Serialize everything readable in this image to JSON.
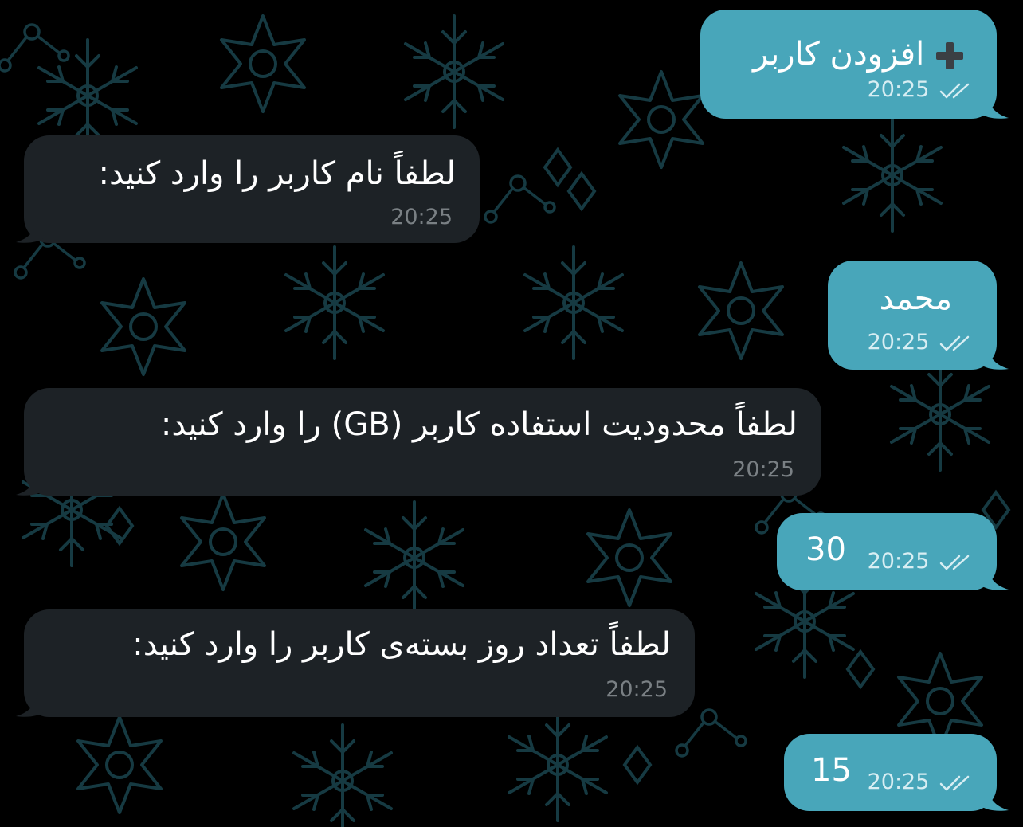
{
  "colors": {
    "background": "#000000",
    "pattern": "#16333a",
    "incoming_bubble": "#1d2226",
    "outgoing_bubble": "#48a6ba",
    "incoming_time": "#7a8084",
    "outgoing_time": "#d8eef3"
  },
  "messages": [
    {
      "direction": "outgoing",
      "text": "افزودن کاربر",
      "icon": "plus-icon",
      "time": "20:25",
      "status": "read-double-check"
    },
    {
      "direction": "incoming",
      "text": "لطفاً نام کاربر را وارد کنید:",
      "time": "20:25"
    },
    {
      "direction": "outgoing",
      "text": "محمد",
      "time": "20:25",
      "status": "read-double-check"
    },
    {
      "direction": "incoming",
      "text": "لطفاً محدودیت استفاده کاربر (GB) را وارد کنید:",
      "time": "20:25"
    },
    {
      "direction": "outgoing",
      "text": "30",
      "time": "20:25",
      "status": "read-double-check"
    },
    {
      "direction": "incoming",
      "text": "لطفاً تعداد روز بسته‌ی کاربر را وارد کنید:",
      "time": "20:25"
    },
    {
      "direction": "outgoing",
      "text": "15",
      "time": "20:25",
      "status": "read-double-check"
    }
  ]
}
